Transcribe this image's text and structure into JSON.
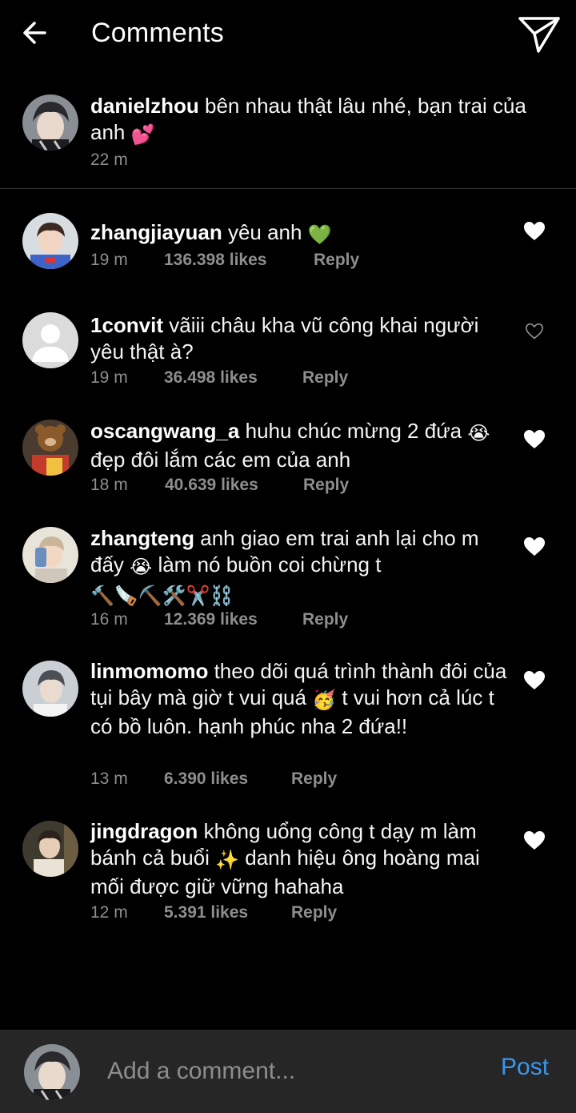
{
  "header": {
    "title": "Comments",
    "back_icon": "arrow-left-icon",
    "share_icon": "paper-plane-icon"
  },
  "caption": {
    "username": "danielzhou",
    "text": "bên nhau thật lâu nhé, bạn trai của anh",
    "emoji": "💕",
    "time": "22 m"
  },
  "comments": [
    {
      "username": "zhangjiayuan",
      "text": "yêu anh",
      "emoji": "💚",
      "time": "19 m",
      "likes": "136.398 likes",
      "reply": "Reply",
      "liked": true
    },
    {
      "username": "1convit",
      "text": "vãiii châu kha vũ công khai người yêu thật à?",
      "emoji": "",
      "time": "19 m",
      "likes": "36.498 likes",
      "reply": "Reply",
      "liked": false
    },
    {
      "username": "oscangwang_a",
      "text": "huhu chúc mừng 2 đứa",
      "emoji": "😭",
      "text2": "đẹp đôi lắm các em của anh",
      "time": "18 m",
      "likes": "40.639 likes",
      "reply": "Reply",
      "liked": true
    },
    {
      "username": "zhangteng",
      "text": "anh giao em trai anh lại cho m đấy",
      "emoji": "😭",
      "text2": "làm nó buồn coi chừng t",
      "emoji2": "🔨🪚⛏️🛠️✂️⛓️",
      "time": "16 m",
      "likes": "12.369 likes",
      "reply": "Reply",
      "liked": true
    },
    {
      "username": "linmomomo",
      "text": "theo dõi quá trình thành đôi của tụi bây mà giờ t vui quá",
      "emoji": "🥳",
      "text2": "t vui hơn cả lúc t có bồ luôn. hạnh phúc nha 2 đứa!!",
      "time": "13 m",
      "likes": "6.390 likes",
      "reply": "Reply",
      "liked": true
    },
    {
      "username": "jingdragon",
      "text": "không uổng công t dạy m làm bánh cả buổi",
      "emoji": "✨",
      "text2": "danh hiệu ông hoàng mai mối được giữ vững hahaha",
      "time": "12 m",
      "likes": "5.391 likes",
      "reply": "Reply",
      "liked": true
    }
  ],
  "bottom": {
    "placeholder": "Add a comment...",
    "post_label": "Post"
  },
  "colors": {
    "background": "#000000",
    "text": "#f5f5f5",
    "meta": "#8e8e8e",
    "link": "#3897f0",
    "input_bar": "#262626"
  }
}
